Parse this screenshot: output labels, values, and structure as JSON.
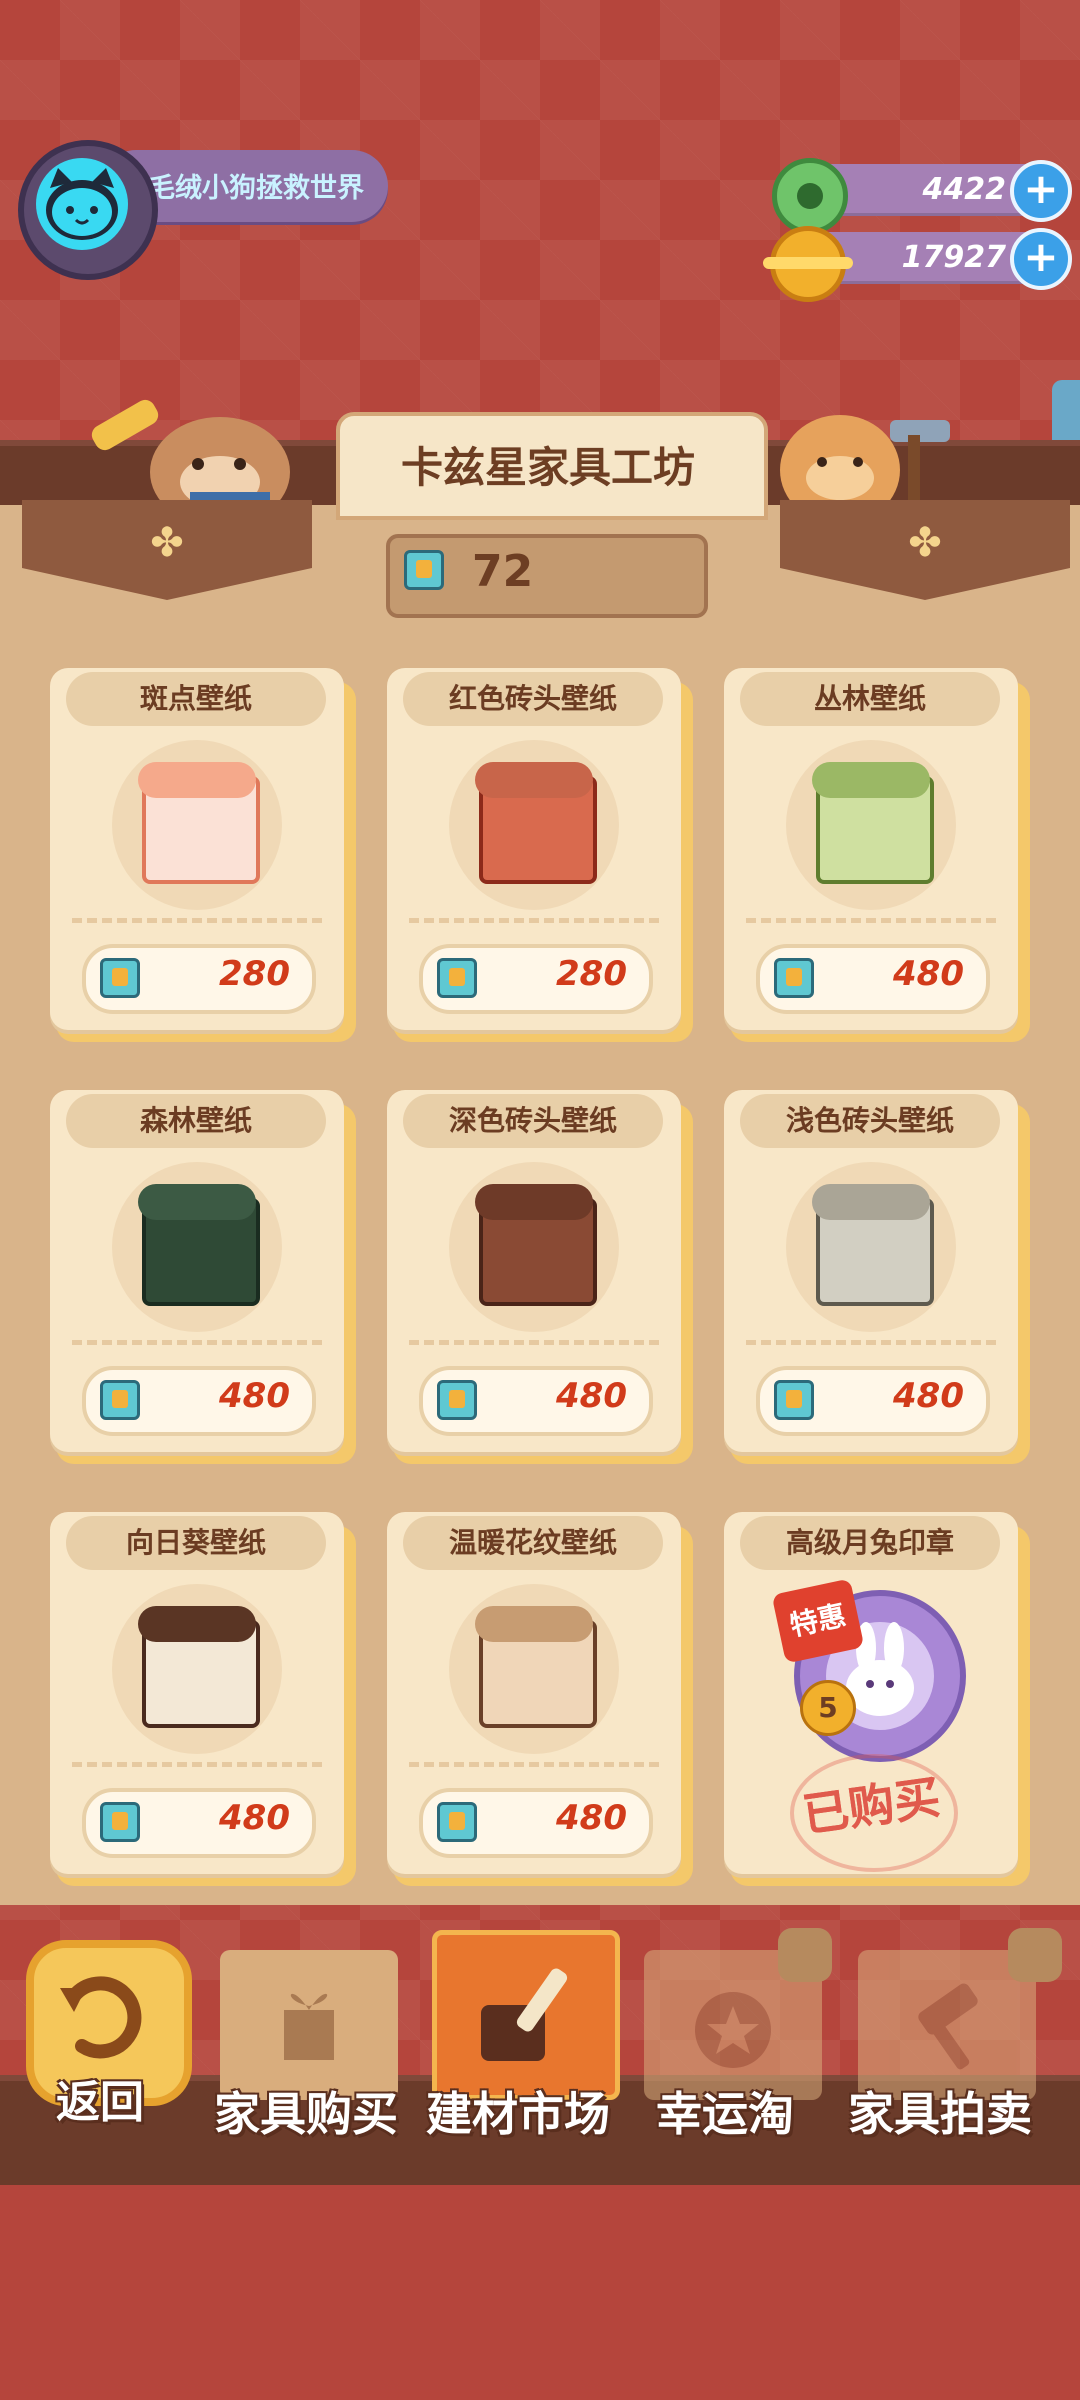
{
  "player": {
    "name": "毛绒小狗拯救世界"
  },
  "currency": {
    "green": {
      "value": "4422",
      "icon": "green-donut-coin-icon"
    },
    "gold": {
      "value": "17927",
      "icon": "gold-planet-coin-icon"
    }
  },
  "shop": {
    "title": "卡兹星家具工坊",
    "tickets": "72"
  },
  "items": [
    {
      "name": "斑点壁纸",
      "price": "280"
    },
    {
      "name": "红色砖头壁纸",
      "price": "280"
    },
    {
      "name": "丛林壁纸",
      "price": "480"
    },
    {
      "name": "森林壁纸",
      "price": "480"
    },
    {
      "name": "深色砖头壁纸",
      "price": "480"
    },
    {
      "name": "浅色砖头壁纸",
      "price": "480"
    },
    {
      "name": "向日葵壁纸",
      "price": "480"
    },
    {
      "name": "温暖花纹壁纸",
      "price": "480"
    },
    {
      "name": "高级月兔印章",
      "badge": "特惠",
      "badge_num": "5",
      "status": "已购买"
    }
  ],
  "nav": {
    "back": "返回",
    "furniture_buy": "家具购买",
    "materials_market": "建材市场",
    "lucky_draw": "幸运淘",
    "furniture_auction": "家具拍卖"
  },
  "colors": {
    "background": "#b5453c",
    "card": "#f8e7c8",
    "price": "#d13b1a",
    "active_tab": "#e8762e"
  }
}
